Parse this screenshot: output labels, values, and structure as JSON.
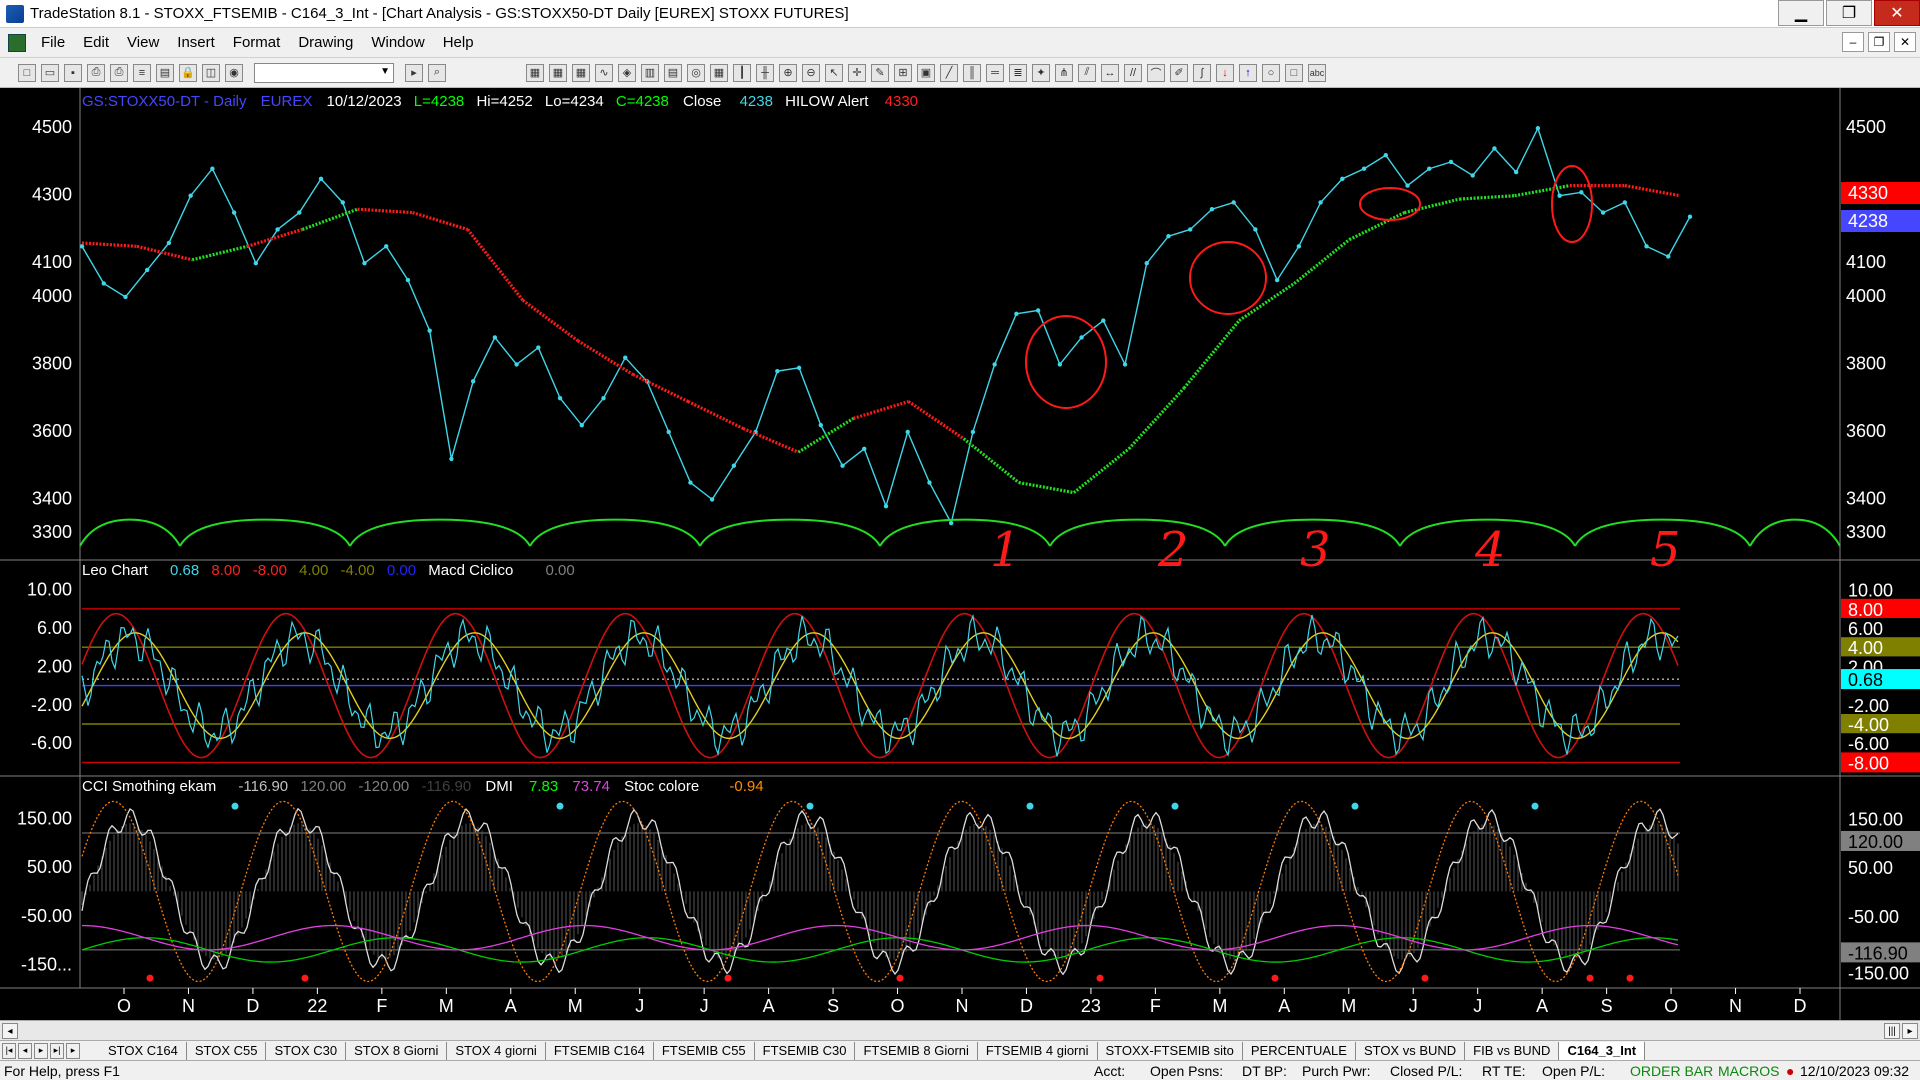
{
  "window": {
    "title": "TradeStation 8.1 - STOXX_FTSEMIB - C164_3_Int - [Chart Analysis - GS:STOXX50-DT  Daily  [EUREX] STOXX FUTURES]"
  },
  "menu": [
    "File",
    "Edit",
    "View",
    "Insert",
    "Format",
    "Drawing",
    "Window",
    "Help"
  ],
  "chart_header": {
    "symbol": "GS:STOXX50-DT - Daily",
    "exchange": "EUREX",
    "date": "10/12/2023",
    "last": "L=4238",
    "high": "Hi=4252",
    "low": "Lo=4234",
    "close": "C=4238",
    "close_label": "Close",
    "close_val": "4238",
    "alert_label": "HILOW Alert",
    "alert_val": "4330"
  },
  "panel2_header": {
    "name": "Leo Chart",
    "v1": "0.68",
    "v2": "8.00",
    "v3": "-8.00",
    "v4": "4.00",
    "v5": "-4.00",
    "v6": "0.00",
    "macd_label": "Macd Ciclico",
    "macd_val": "0.00"
  },
  "panel3_header": {
    "name": "CCI Smothing ekam",
    "v1": "-116.90",
    "v2": "120.00",
    "v3": "-120.00",
    "v4": "-116.90",
    "dmi_label": "DMI",
    "dmi1": "7.83",
    "dmi2": "73.74",
    "stoc_label": "Stoc colore",
    "stoc_val": "-0.94"
  },
  "chart_data": [
    {
      "type": "line",
      "panel": "price",
      "ylim": [
        3250,
        4560
      ],
      "y_ticks_left": [
        "4500",
        "4300",
        "4100",
        "4000",
        "3800",
        "3600",
        "3400",
        "3300"
      ],
      "y_ticks_right": [
        "4500",
        "4300",
        "4100",
        "4000",
        "3800",
        "3600",
        "3400",
        "3300"
      ],
      "value_tags": [
        {
          "value": "4330",
          "color": "#ff0000"
        },
        {
          "value": "4238",
          "color": "#4646ff"
        }
      ],
      "x_labels": [
        "O",
        "N",
        "D",
        "22",
        "F",
        "M",
        "A",
        "M",
        "J",
        "J",
        "A",
        "S",
        "O",
        "N",
        "D",
        "23",
        "F",
        "M",
        "A",
        "M",
        "J",
        "J",
        "A",
        "S",
        "O",
        "N",
        "D"
      ],
      "cycle_labels": [
        "1",
        "2",
        "3",
        "4",
        "5"
      ],
      "series": [
        {
          "name": "Close",
          "color": "#3fd6e8",
          "values": [
            4150,
            4040,
            4000,
            4080,
            4160,
            4300,
            4380,
            4250,
            4100,
            4200,
            4250,
            4350,
            4280,
            4100,
            4150,
            4050,
            3900,
            3520,
            3750,
            3880,
            3800,
            3850,
            3700,
            3620,
            3700,
            3820,
            3750,
            3600,
            3450,
            3400,
            3500,
            3600,
            3780,
            3790,
            3620,
            3500,
            3550,
            3380,
            3600,
            3450,
            3330,
            3600,
            3800,
            3950,
            3960,
            3800,
            3880,
            3930,
            3800,
            4100,
            4180,
            4200,
            4260,
            4280,
            4200,
            4050,
            4150,
            4280,
            4350,
            4380,
            4420,
            4330,
            4380,
            4400,
            4360,
            4440,
            4370,
            4500,
            4300,
            4310,
            4250,
            4280,
            4150,
            4120,
            4238
          ]
        },
        {
          "name": "Average",
          "values": [
            4160,
            4150,
            4110,
            4150,
            4200,
            4260,
            4250,
            4200,
            3990,
            3870,
            3770,
            3690,
            3610,
            3540,
            3640,
            3690,
            3580,
            3450,
            3420,
            3550,
            3730,
            3930,
            4040,
            4170,
            4250,
            4290,
            4300,
            4330,
            4330,
            4300
          ]
        }
      ]
    },
    {
      "type": "line",
      "panel": "Leo Chart",
      "ylim": [
        -9,
        11
      ],
      "y_ticks": [
        "10.00",
        "6.00",
        "2.00",
        "-2.00",
        "-6.00"
      ],
      "right_tags": [
        {
          "value": "10.00",
          "color": "#000000"
        },
        {
          "value": "8.00",
          "color": "#ff0000"
        },
        {
          "value": "6.00",
          "color": "#000000"
        },
        {
          "value": "4.00",
          "color": "#808000"
        },
        {
          "value": "2.00",
          "color": "#000000"
        },
        {
          "value": "0.68",
          "color": "#00ffff"
        },
        {
          "value": "-2.00",
          "color": "#000000"
        },
        {
          "value": "-4.00",
          "color": "#808000"
        },
        {
          "value": "-6.00",
          "color": "#000000"
        },
        {
          "value": "-8.00",
          "color": "#ff0000"
        }
      ],
      "levels": [
        8,
        4,
        0,
        -4,
        -8
      ]
    },
    {
      "type": "line",
      "panel": "CCI",
      "ylim": [
        -190,
        200
      ],
      "y_ticks": [
        "150.00",
        "50.00",
        "-50.00",
        "-150..."
      ],
      "right_tags": [
        {
          "value": "150.00",
          "color": "#000000"
        },
        {
          "value": "120.00",
          "color": "#808080"
        },
        {
          "value": "50.00",
          "color": "#000000"
        },
        {
          "value": "-50.00",
          "color": "#000000"
        },
        {
          "value": "-116.90",
          "color": "#808080"
        },
        {
          "value": "-150.00",
          "color": "#000000"
        }
      ]
    }
  ],
  "tabs": [
    "STOX C164",
    "STOX C55",
    "STOX  C30",
    "STOX  8 Giorni",
    "STOX 4 giorni",
    "FTSEMIB C164",
    "FTSEMIB C55",
    "FTSEMIB C30",
    "FTSEMIB  8 Giorni",
    "FTSEMIB  4 giorni",
    "STOXX-FTSEMIB sito",
    "PERCENTUALE",
    "STOX vs BUND",
    "FIB vs BUND",
    "C164_3_Int"
  ],
  "status": {
    "help": "For Help, press F1",
    "acct": "Acct:",
    "open_psns": "Open Psns:",
    "dtbp": "DT BP:",
    "purch_pwr": "Purch Pwr:",
    "closed_pl": "Closed P/L:",
    "rt_te": "RT TE:",
    "open_pl": "Open P/L:",
    "order_bar": "ORDER BAR",
    "macros": "MACROS",
    "datetime": "12/10/2023 09:32"
  }
}
